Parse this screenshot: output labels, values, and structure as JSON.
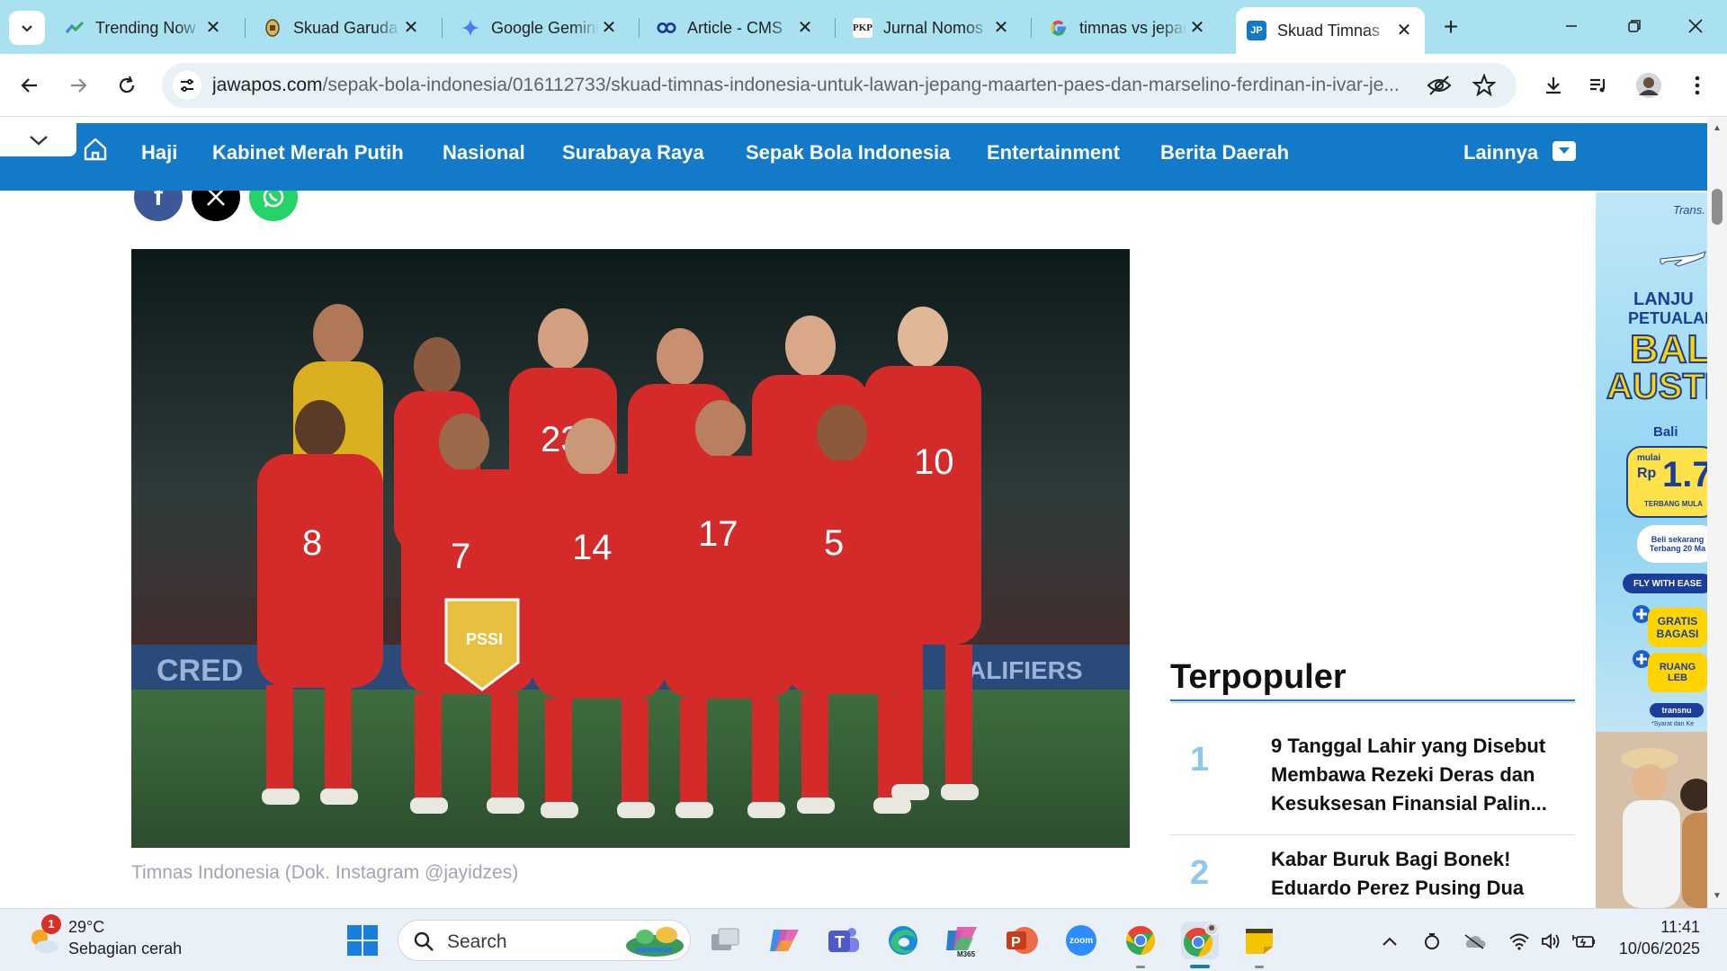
{
  "browser": {
    "tabs": [
      {
        "title": "Trending Now",
        "favicon": "trends-icon",
        "color": "#34a853"
      },
      {
        "title": "Skuad Garuda",
        "favicon": "garuda-icon",
        "color": "#8a6d3b"
      },
      {
        "title": "Google Gemini",
        "favicon": "gemini-sparkle-icon",
        "color": "#4a7bf7"
      },
      {
        "title": "Article - CMS",
        "favicon": "cms-icon",
        "color": "#1f3a93"
      },
      {
        "title": "Jurnal Nomos",
        "favicon": "pkp-icon",
        "label": "PKP",
        "color": "#222222"
      },
      {
        "title": "timnas vs jepang",
        "favicon": "google-g-icon",
        "color": "#4285f4"
      },
      {
        "title": "Skuad Timnas",
        "favicon": "jp-icon",
        "label": "JP",
        "color": "#1379c9"
      }
    ],
    "active_tab_index": 6,
    "new_tab_label": "+",
    "url": {
      "host": "jawapos.com",
      "path": "/sepak-bola-indonesia/016112733/skuad-timnas-indonesia-untuk-lawan-jepang-maarten-paes-dan-marselino-ferdinan-in-ivar-je..."
    }
  },
  "site": {
    "accent": "#1379c9",
    "nav": [
      "Haji",
      "Kabinet Merah Putih",
      "Nasional",
      "Surabaya Raya",
      "Sepak Bola Indonesia",
      "Entertainment",
      "Berita Daerah"
    ],
    "more_label": "Lainnya"
  },
  "article": {
    "share_buttons": [
      {
        "name": "facebook-share-button",
        "icon": "facebook-icon",
        "glyph": "f",
        "color": "#3b5998"
      },
      {
        "name": "x-share-button",
        "icon": "x-icon",
        "glyph": "𝕏",
        "color": "#000000"
      },
      {
        "name": "whatsapp-share-button",
        "icon": "whatsapp-icon",
        "glyph": "✆",
        "color": "#25d366"
      }
    ],
    "photo_caption": "Timnas Indonesia (Dok. Instagram @jayidzes)",
    "photo_banner_left": "CRED",
    "photo_banner_right": "ALIFIERS",
    "pennant_label": "PSSI",
    "jersey_numbers": [
      "8",
      "7",
      "14",
      "17",
      "5",
      "23",
      "10"
    ]
  },
  "sidebar": {
    "title": "Terpopuler",
    "items": [
      {
        "rank": "1",
        "title": "9 Tanggal Lahir yang Disebut Membawa Rezeki Deras dan Kesuksesan Finansial Palin..."
      },
      {
        "rank": "2",
        "title": "Kabar Buruk Bagi Bonek! Eduardo Perez Pusing Dua"
      }
    ]
  },
  "ad": {
    "brand": "Trans.",
    "headline_1": "LANJU",
    "headline_2": "PETUALAN",
    "headline_3": "BALI",
    "headline_4": "AUSTR",
    "route": "Bali",
    "price_prefix": "mulai",
    "price_currency": "Rp",
    "price": "1.7",
    "price_note": "TERBANG MULA",
    "sale_line_1": "Beli sekarang",
    "sale_line_2": "Terbang 20 Ma",
    "fly_label": "FLY WITH EASE",
    "gratis": "GRATIS",
    "bagasi": "BAGASI",
    "ruang": "RUANG",
    "ruang_suffix": "LEB",
    "footer_brand": "transnu",
    "footer_note": "*Syarat dan Ke"
  },
  "taskbar": {
    "weather": {
      "temp": "29°C",
      "desc": "Sebagian cerah",
      "badge": "1"
    },
    "search_label": "Search",
    "apps": [
      {
        "name": "task-view-app",
        "icon": "task-view-icon",
        "color": "#7a7a7a",
        "label": ""
      },
      {
        "name": "copilot-app",
        "icon": "copilot-icon",
        "color": "#8a5cf6",
        "label": ""
      },
      {
        "name": "teams-app",
        "icon": "teams-icon",
        "color": "#5059c9",
        "label": "T"
      },
      {
        "name": "edge-app",
        "icon": "edge-icon",
        "color": "#1b8ad8",
        "label": "e"
      },
      {
        "name": "m365-app",
        "icon": "m365-icon",
        "color": "#2b7cd3",
        "label": "M365"
      },
      {
        "name": "powerpoint-app",
        "icon": "powerpoint-icon",
        "color": "#c43e1c",
        "label": "P"
      },
      {
        "name": "zoom-app",
        "icon": "zoom-icon",
        "color": "#2d8cff",
        "label": "zoom"
      },
      {
        "name": "chrome-app",
        "icon": "chrome-icon",
        "color": "#e8453c",
        "label": ""
      },
      {
        "name": "chrome-profile-app",
        "icon": "chrome-icon",
        "color": "#e8453c",
        "label": ""
      },
      {
        "name": "sticky-notes-app",
        "icon": "sticky-notes-icon",
        "color": "#f5c400",
        "label": ""
      }
    ],
    "clock": {
      "time": "11:41",
      "date": "10/06/2025"
    }
  }
}
